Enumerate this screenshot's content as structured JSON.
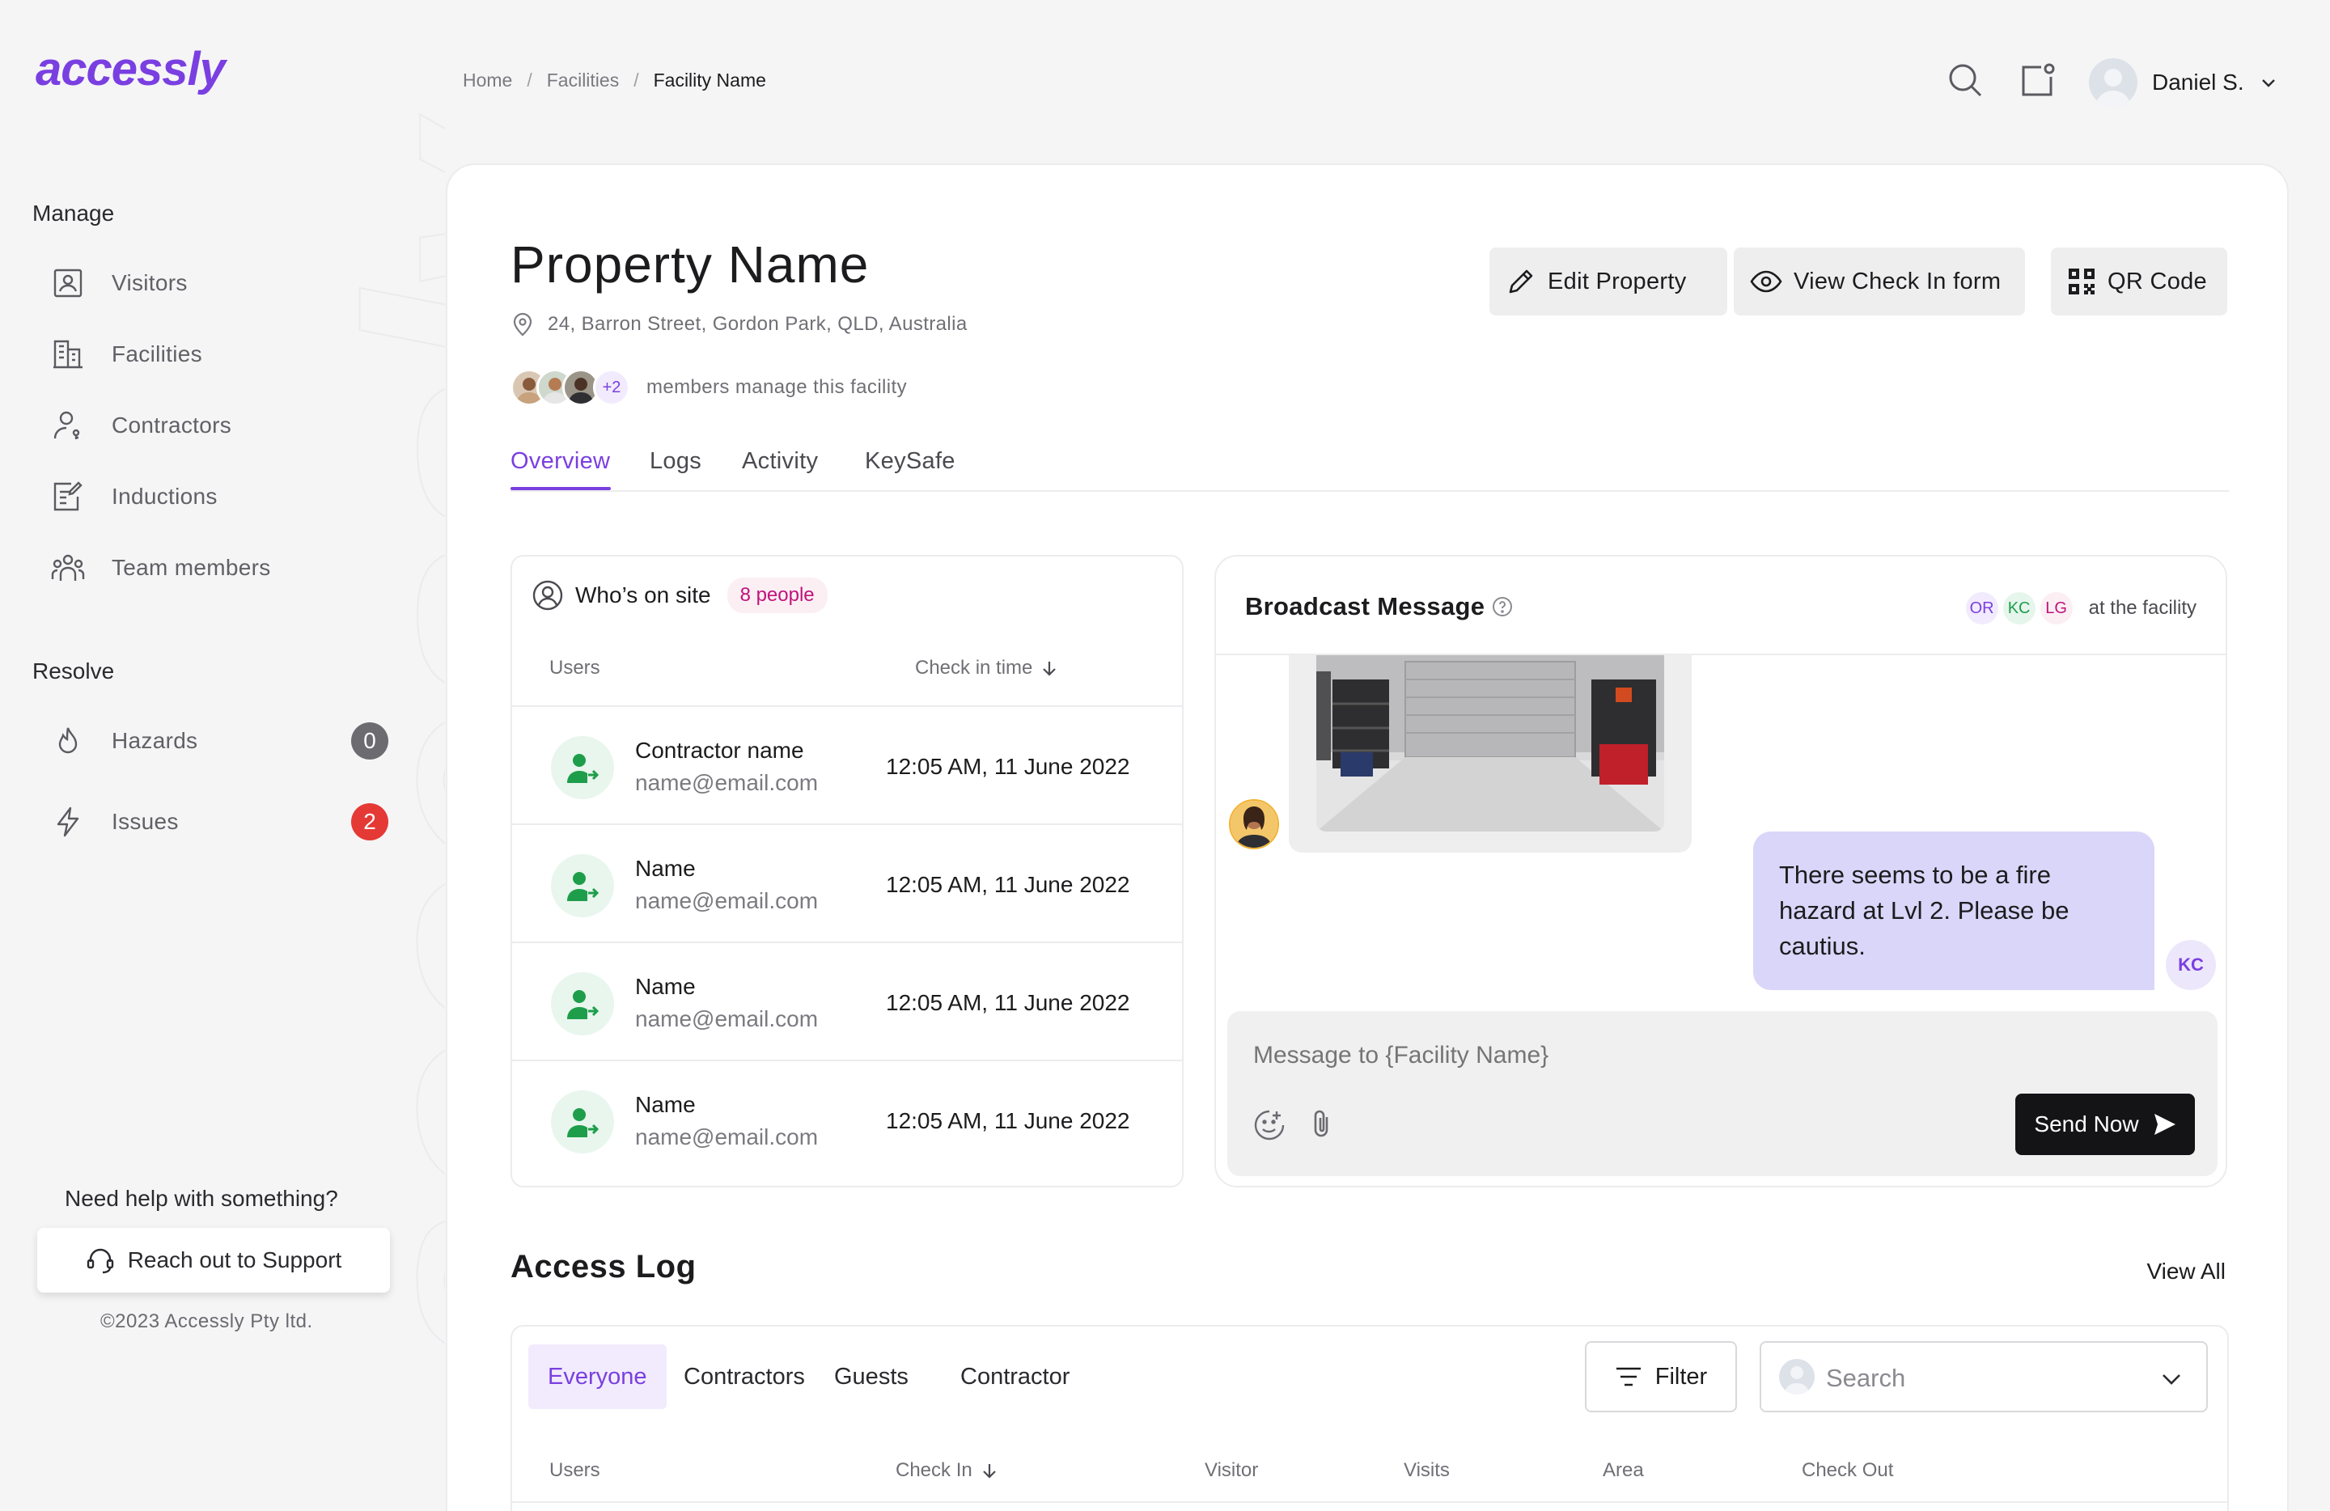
{
  "brand": {
    "logo": "accessly",
    "watermark": "accessly",
    "accent": "#7a3fe0"
  },
  "sidebar": {
    "manage_title": "Manage",
    "manage_items": [
      {
        "label": "Visitors",
        "icon": "visitor-badge-icon"
      },
      {
        "label": "Facilities",
        "icon": "building-icon"
      },
      {
        "label": "Contractors",
        "icon": "person-key-icon"
      },
      {
        "label": "Inductions",
        "icon": "edit-document-icon"
      },
      {
        "label": "Team members",
        "icon": "team-icon"
      }
    ],
    "resolve_title": "Resolve",
    "resolve_items": [
      {
        "label": "Hazards",
        "icon": "flame-icon",
        "badge": "0",
        "badge_color": "#6b6b70"
      },
      {
        "label": "Issues",
        "icon": "lightning-icon",
        "badge": "2",
        "badge_color": "#e53935"
      }
    ],
    "help_text": "Need help with something?",
    "support_label": "Reach out to Support",
    "copyright": "©2023 Accessly Pty ltd."
  },
  "topbar": {
    "breadcrumb": [
      "Home",
      "Facilities",
      "Facility Name"
    ],
    "breadcrumb_sep": "/",
    "user_name": "Daniel S."
  },
  "property": {
    "title": "Property Name",
    "address": "24, Barron Street, Gordon Park, QLD, Australia",
    "members_extra": "+2",
    "members_text": "members manage this facility",
    "buttons": {
      "edit": "Edit Property",
      "view_form": "View Check In form",
      "qr": "QR Code"
    },
    "tabs": [
      "Overview",
      "Logs",
      "Activity",
      "KeySafe"
    ],
    "active_tab": "Overview"
  },
  "onsite": {
    "title": "Who’s on site",
    "count_label": "8 people",
    "col_users": "Users",
    "col_checkin": "Check in time",
    "rows": [
      {
        "name": "Contractor name",
        "email": "name@email.com",
        "time": "12:05 AM, 11 June 2022"
      },
      {
        "name": "Name",
        "email": "name@email.com",
        "time": "12:05 AM, 11 June 2022"
      },
      {
        "name": "Name",
        "email": "name@email.com",
        "time": "12:05 AM, 11 June 2022"
      },
      {
        "name": "Name",
        "email": "name@email.com",
        "time": "12:05 AM, 11 June 2022"
      }
    ]
  },
  "broadcast": {
    "title": "Broadcast Message",
    "initials": [
      {
        "text": "OR",
        "fg": "#7a3fe0",
        "bg": "#f1ebfd"
      },
      {
        "text": "KC",
        "fg": "#1e9e4a",
        "bg": "#e6f6ec"
      },
      {
        "text": "LG",
        "fg": "#c1127c",
        "bg": "#fbeff4"
      }
    ],
    "at_text": "at the facility",
    "message": "There seems to be a fire hazard at Lvl 2. Please be cautius.",
    "sender_initials": "KC",
    "input_placeholder": "Message to {Facility Name}",
    "send_label": "Send Now"
  },
  "access_log": {
    "title": "Access Log",
    "view_all": "View All",
    "segments": [
      "Everyone",
      "Contractors",
      "Guests",
      "Contractor"
    ],
    "active_segment": "Everyone",
    "filter_label": "Filter",
    "search_placeholder": "Search",
    "columns": [
      "Users",
      "Check In",
      "Visitor",
      "Visits",
      "Area",
      "Check Out"
    ]
  }
}
